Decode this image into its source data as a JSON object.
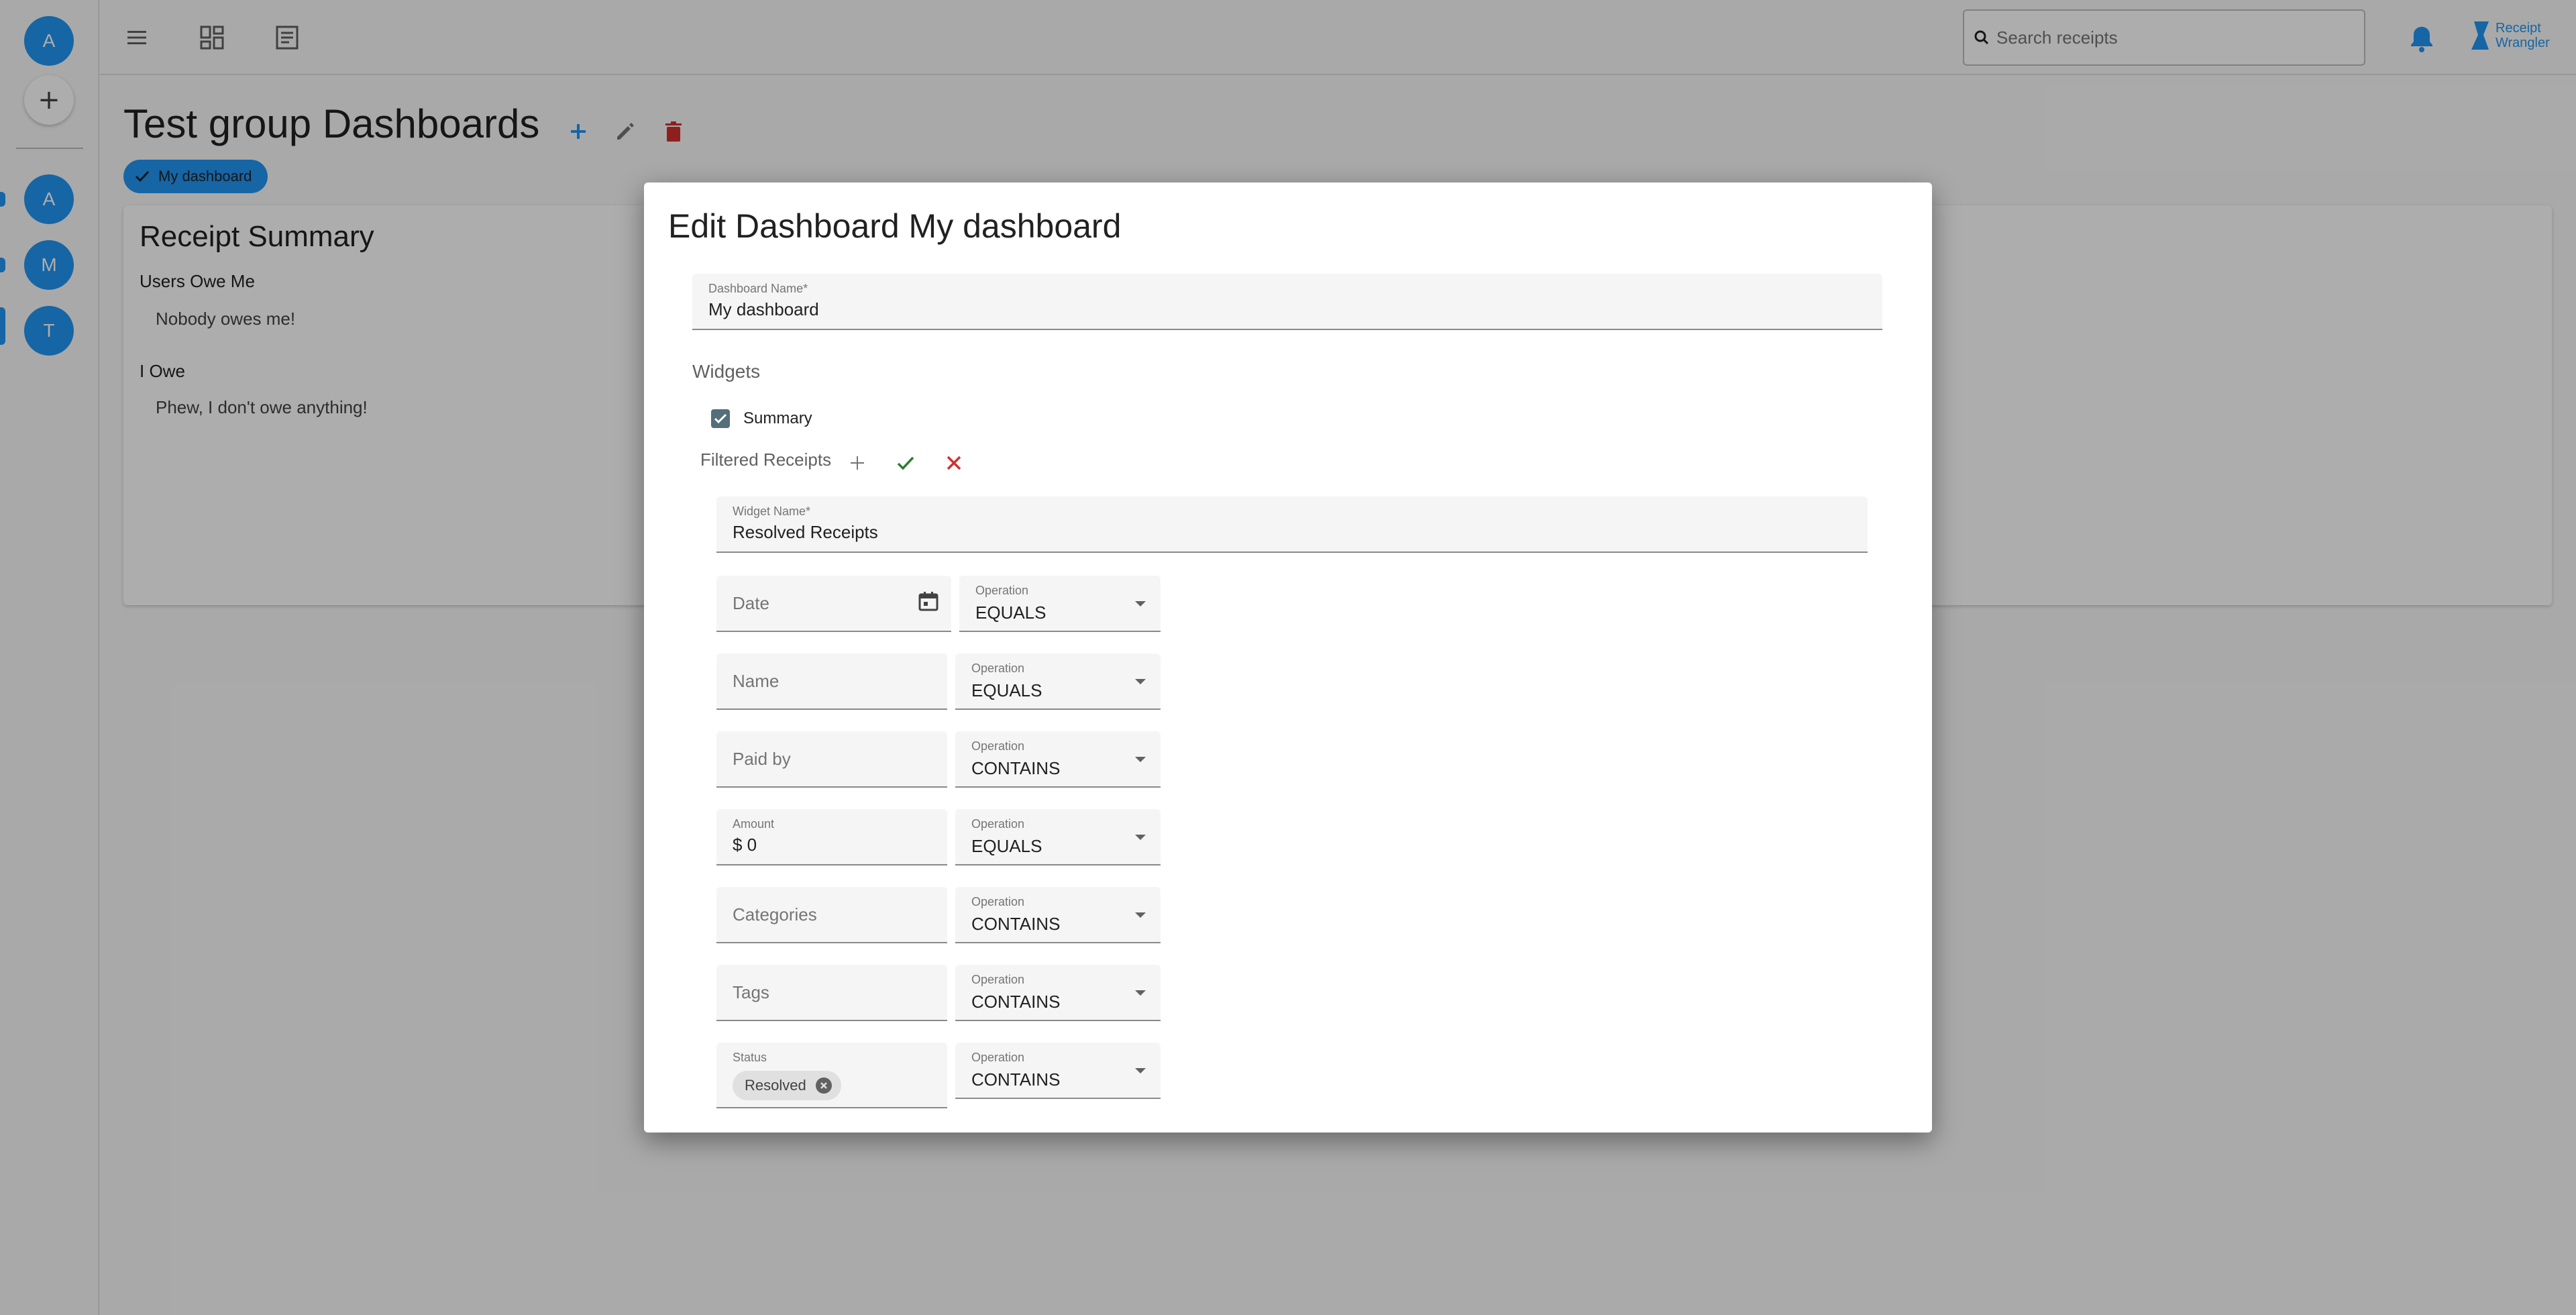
{
  "rail": {
    "top_avatar": "A",
    "add_symbol": "+",
    "groups": [
      "A",
      "M",
      "T"
    ]
  },
  "topbar": {
    "menu_icon": "menu-icon",
    "dashboard_icon": "dashboard-grid-icon",
    "receipts_icon": "receipt-list-icon",
    "search_placeholder": "Search receipts",
    "brand_line1": "Receipt",
    "brand_line2": "Wrangler"
  },
  "page": {
    "title": "Test group Dashboards",
    "dashboard_chip": "My dashboard"
  },
  "summary_card": {
    "title": "Receipt Summary",
    "owe_me_heading": "Users Owe Me",
    "owe_me_text": "Nobody owes me!",
    "i_owe_heading": "I Owe",
    "i_owe_text": "Phew, I don't owe anything!"
  },
  "dialog": {
    "title": "Edit Dashboard My dashboard",
    "dashboard_name_label": "Dashboard Name",
    "dashboard_name_value": "My dashboard",
    "widgets_heading": "Widgets",
    "summary_checkbox_label": "Summary",
    "summary_checked": true,
    "filtered_receipts_label": "Filtered Receipts",
    "widget_name_label": "Widget Name",
    "widget_name_value": "Resolved Receipts",
    "filters": [
      {
        "field": "Date",
        "operation_label": "Operation",
        "operation": "EQUALS"
      },
      {
        "field": "Name",
        "operation_label": "Operation",
        "operation": "EQUALS"
      },
      {
        "field": "Paid by",
        "operation_label": "Operation",
        "operation": "CONTAINS"
      },
      {
        "field": "Amount",
        "value": "$ 0",
        "operation_label": "Operation",
        "operation": "EQUALS"
      },
      {
        "field": "Categories",
        "operation_label": "Operation",
        "operation": "CONTAINS"
      },
      {
        "field": "Tags",
        "operation_label": "Operation",
        "operation": "CONTAINS"
      },
      {
        "field": "Status",
        "chip": "Resolved",
        "operation_label": "Operation",
        "operation": "CONTAINS"
      }
    ]
  },
  "colors": {
    "primary": "#2196f3",
    "danger": "#d32f2f",
    "success": "#2e7d32"
  }
}
